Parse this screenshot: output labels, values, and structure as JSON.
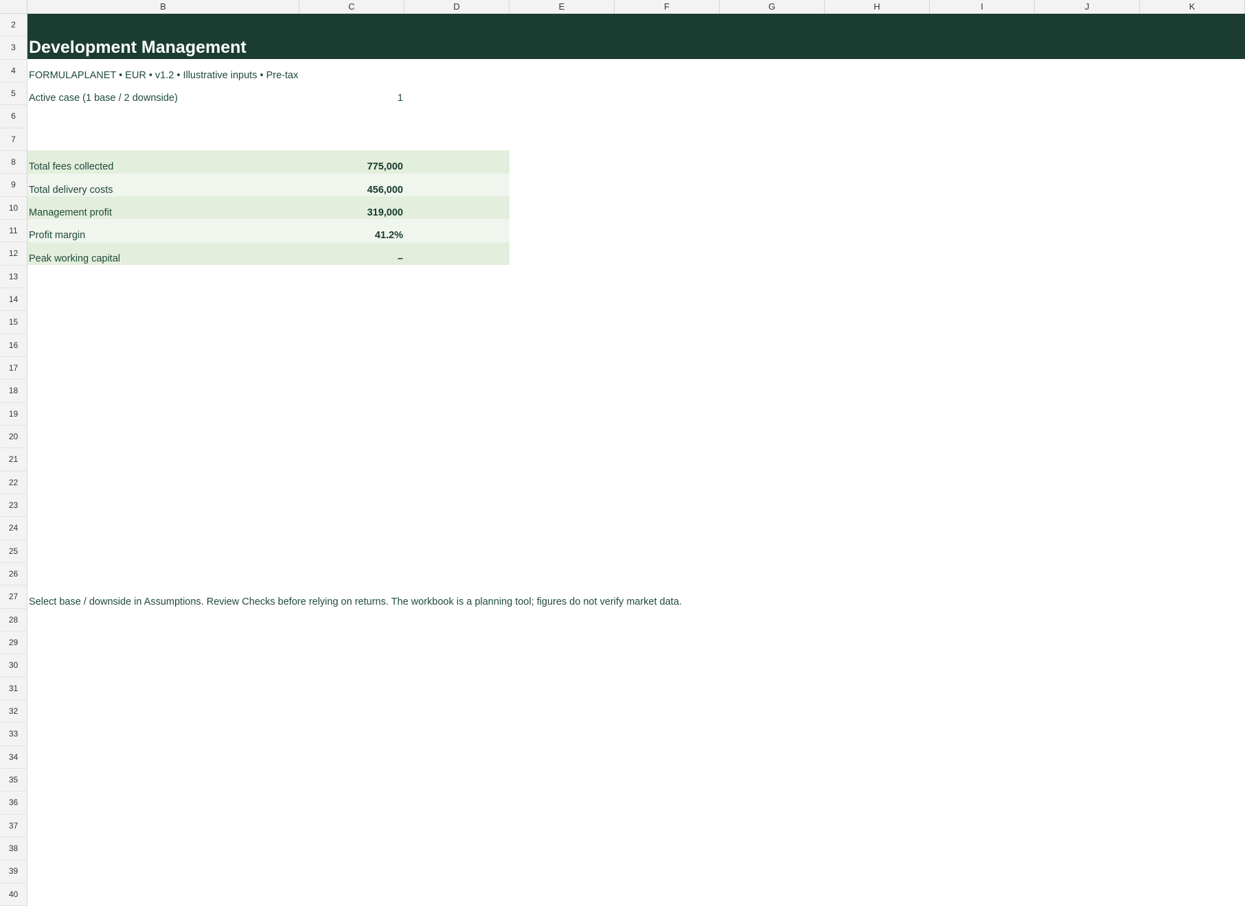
{
  "columns": [
    "B",
    "C",
    "D",
    "E",
    "F",
    "G",
    "H",
    "I",
    "J",
    "K"
  ],
  "rows": [
    "2",
    "3",
    "4",
    "5",
    "6",
    "7",
    "8",
    "9",
    "10",
    "11",
    "12",
    "13",
    "14",
    "15",
    "16",
    "17",
    "18",
    "19",
    "20",
    "21",
    "22",
    "23",
    "24",
    "25",
    "26",
    "27",
    "28",
    "29",
    "30",
    "31",
    "32",
    "33",
    "34",
    "35",
    "36",
    "37",
    "38",
    "39",
    "40"
  ],
  "header": {
    "title": "Development Management",
    "subtitle": "FORMULAPLANET  •  EUR  •  v1.2  •  Illustrative inputs  •  Pre-tax"
  },
  "active_case": {
    "label": "Active case (1 base / 2 downside)",
    "value": "1"
  },
  "kpis": [
    {
      "label": "Total fees collected",
      "value": "775,000"
    },
    {
      "label": "Total delivery costs",
      "value": "456,000"
    },
    {
      "label": "Management profit",
      "value": "319,000"
    },
    {
      "label": "Profit margin",
      "value": "41.2%"
    },
    {
      "label": "Peak working capital",
      "value": "–"
    }
  ],
  "footnote": "Select base / downside in Assumptions. Review Checks before relying on returns. The workbook is a planning tool; figures do not verify market data.",
  "colors": {
    "title_band": "#1b3d31",
    "kpi_band_a": "#e3efdc",
    "kpi_band_b": "#f0f5ee",
    "text": "#1f4a3c"
  }
}
